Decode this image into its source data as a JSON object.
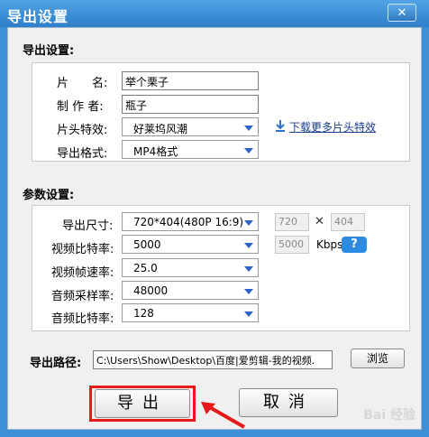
{
  "window": {
    "title": "导出设置",
    "close_label": "✕"
  },
  "export_settings": {
    "section_title": "导出设置:",
    "title_label": "片　　名:",
    "title_value": "举个栗子",
    "author_label": "制 作 者:",
    "author_value": "瓶子",
    "intro_effect_label": "片头特效:",
    "intro_effect_value": "好莱坞风潮",
    "download_more_link": "下载更多片头特效",
    "format_label": "导出格式:",
    "format_value": "MP4格式"
  },
  "param_settings": {
    "section_title": "参数设置:",
    "size_label": "导出尺寸:",
    "size_value": "720*404(480P 16:9)",
    "width_value": "720",
    "height_value": "404",
    "x_sign": "✕",
    "video_bitrate_label": "视频比特率:",
    "video_bitrate_value": "5000",
    "custom_bitrate_value": "5000",
    "kbps_label": "Kbps",
    "help_label": "?",
    "fps_label": "视频帧速率:",
    "fps_value": "25.0",
    "audio_sample_label": "音频采样率:",
    "audio_sample_value": "48000",
    "audio_bitrate_label": "音频比特率:",
    "audio_bitrate_value": "128"
  },
  "export_path": {
    "label": "导出路径:",
    "value": "C:\\Users\\Show\\Desktop\\百度|爱剪辑-我的视频.",
    "browse_label": "浏览"
  },
  "actions": {
    "export_label": "导出",
    "cancel_label": "取消"
  },
  "watermark": "Bai 经验",
  "colors": {
    "title_bar": "#3d8fd6",
    "highlight_red": "#e8191b",
    "link_blue": "#1a3d8f"
  }
}
